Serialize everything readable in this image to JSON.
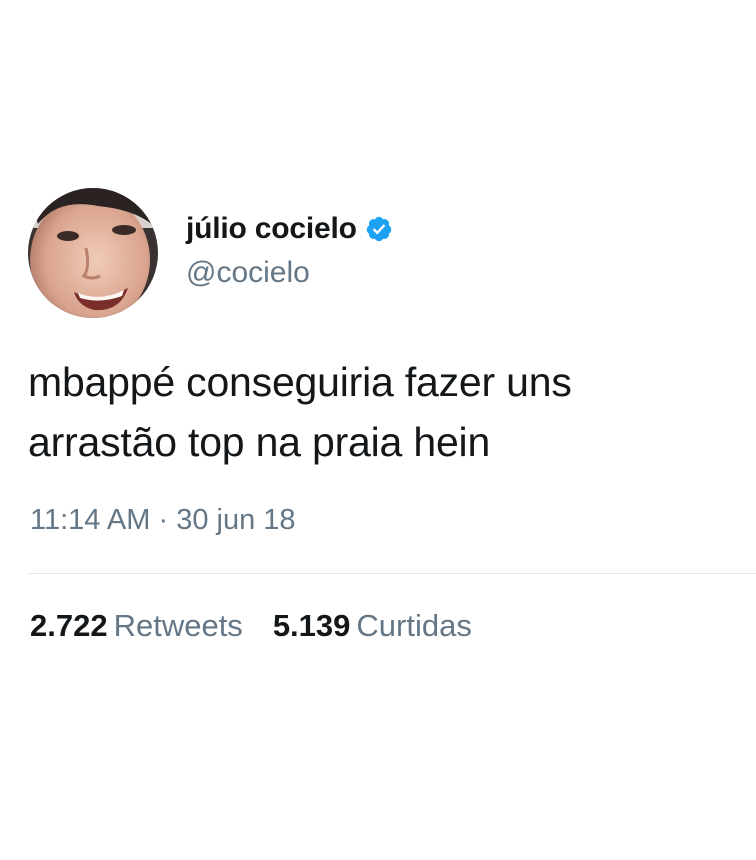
{
  "author": {
    "display_name": "júlio cocielo",
    "handle": "@cocielo",
    "verified": true,
    "avatar_icon": "avatar-photo"
  },
  "tweet": {
    "text_line_1": "mbappé conseguiria fazer uns",
    "text_line_2": "arrastão top na praia hein",
    "time": "11:14 AM",
    "separator": "·",
    "date": "30 jun 18"
  },
  "stats": {
    "retweets_count": "2.722",
    "retweets_label": "Retweets",
    "likes_count": "5.139",
    "likes_label": "Curtidas"
  },
  "colors": {
    "text": "#14171a",
    "secondary": "#657786",
    "verified_blue": "#1da1f2",
    "divider": "#e1e8ed"
  }
}
